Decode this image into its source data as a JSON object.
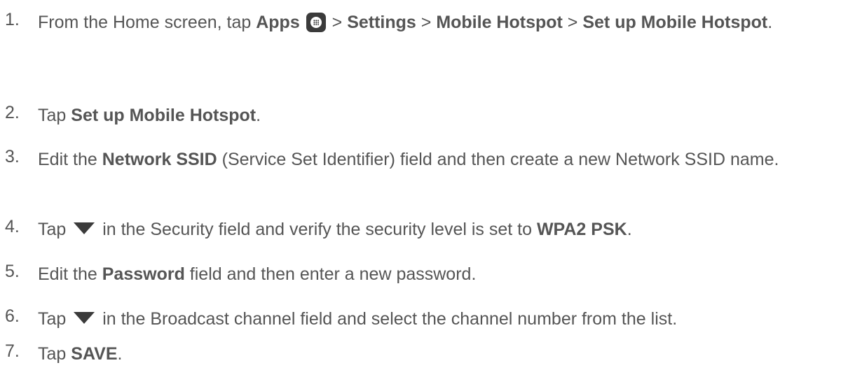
{
  "steps": [
    {
      "num": "1.",
      "parts": [
        "From the Home screen, tap ",
        "Apps",
        " > ",
        "Settings",
        " > ",
        "Mobile Hotspot",
        " > ",
        "Set up Mobile Hotspot",
        "."
      ],
      "icon": "apps-icon"
    },
    {
      "num": "2.",
      "parts": [
        "Tap ",
        "Set up Mobile Hotspot",
        "."
      ]
    },
    {
      "num": "3.",
      "parts": [
        "Edit the ",
        "Network SSID",
        " (Service Set Identifier) field and then create a new Network SSID name."
      ]
    },
    {
      "num": "4.",
      "parts": [
        "Tap ",
        " in the Security field and verify the security level is set to ",
        "WPA2 PSK",
        "."
      ],
      "icon": "dropdown-triangle-icon"
    },
    {
      "num": "5.",
      "parts": [
        "Edit the ",
        "Password",
        " field and then enter a new password."
      ]
    },
    {
      "num": "6.",
      "parts": [
        "Tap ",
        " in the Broadcast channel field and select the channel number from the list."
      ],
      "icon": "dropdown-triangle-icon"
    },
    {
      "num": "7.",
      "parts": [
        "Tap ",
        "SAVE",
        "."
      ]
    }
  ],
  "colors": {
    "text": "#555555",
    "icon": "#3b3b3b"
  }
}
